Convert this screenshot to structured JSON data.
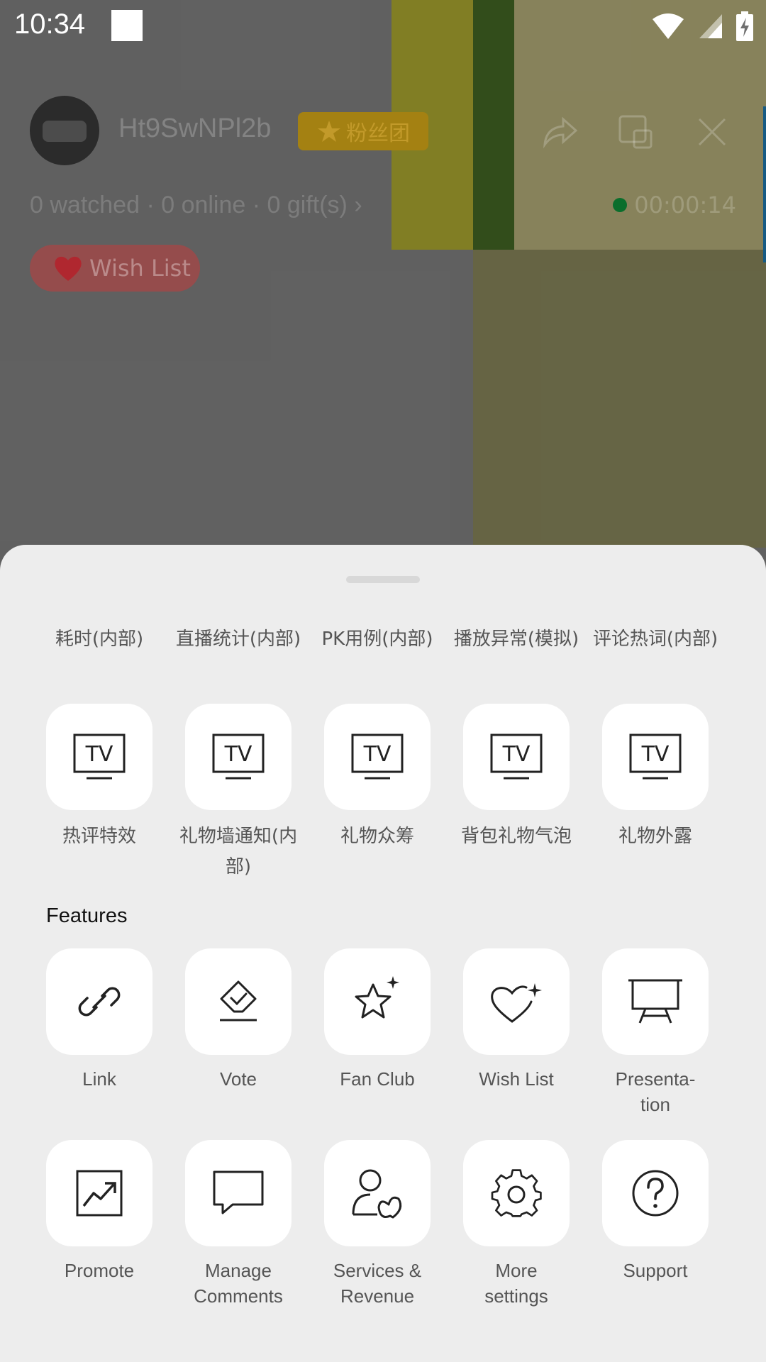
{
  "status_bar": {
    "time": "10:34",
    "icons": [
      "wifi-icon",
      "signal-icon",
      "battery-charging-icon"
    ]
  },
  "room": {
    "host_name": "Ht9SwNPl2b",
    "fan_badge": "粉丝团",
    "stats": "0 watched · 0 online · 0 gift(s) ›",
    "duration": "00:00:14",
    "wish_list_label": "Wish List",
    "header_icons": [
      "share-icon",
      "screen-icon",
      "close-icon"
    ]
  },
  "sheet": {
    "top_labels": [
      "耗时(内部)",
      "直播统计(内部)",
      "PK用例(内部)",
      "播放异常(模拟)",
      "评论热词(内部)"
    ],
    "internal_tools": [
      {
        "label": "热评特效",
        "icon": "tv-icon"
      },
      {
        "label": "礼物墙通知(内部)",
        "icon": "tv-icon"
      },
      {
        "label": "礼物众筹",
        "icon": "tv-icon"
      },
      {
        "label": "背包礼物气泡",
        "icon": "tv-icon"
      },
      {
        "label": "礼物外露",
        "icon": "tv-icon"
      }
    ],
    "features_title": "Features",
    "features_row1": [
      {
        "label": "Link",
        "icon": "link-icon"
      },
      {
        "label": "Vote",
        "icon": "vote-icon"
      },
      {
        "label": "Fan Club",
        "icon": "star-sparkle-icon"
      },
      {
        "label": "Wish List",
        "icon": "heart-sparkle-icon"
      },
      {
        "label": "Presenta-\ntion",
        "icon": "presentation-icon"
      }
    ],
    "features_row2": [
      {
        "label": "Promote",
        "icon": "trend-chart-icon"
      },
      {
        "label": "Manage\nComments",
        "icon": "comment-icon"
      },
      {
        "label": "Services &\nRevenue",
        "icon": "person-butterfly-icon"
      },
      {
        "label": "More\nsettings",
        "icon": "gear-icon"
      },
      {
        "label": "Support",
        "icon": "question-icon"
      }
    ]
  },
  "colors": {
    "sheet_bg": "#ededed",
    "tile_bg": "#ffffff",
    "label_text": "#555555",
    "live_dot": "#0a6e2c",
    "fan_badge": "#a48112"
  }
}
